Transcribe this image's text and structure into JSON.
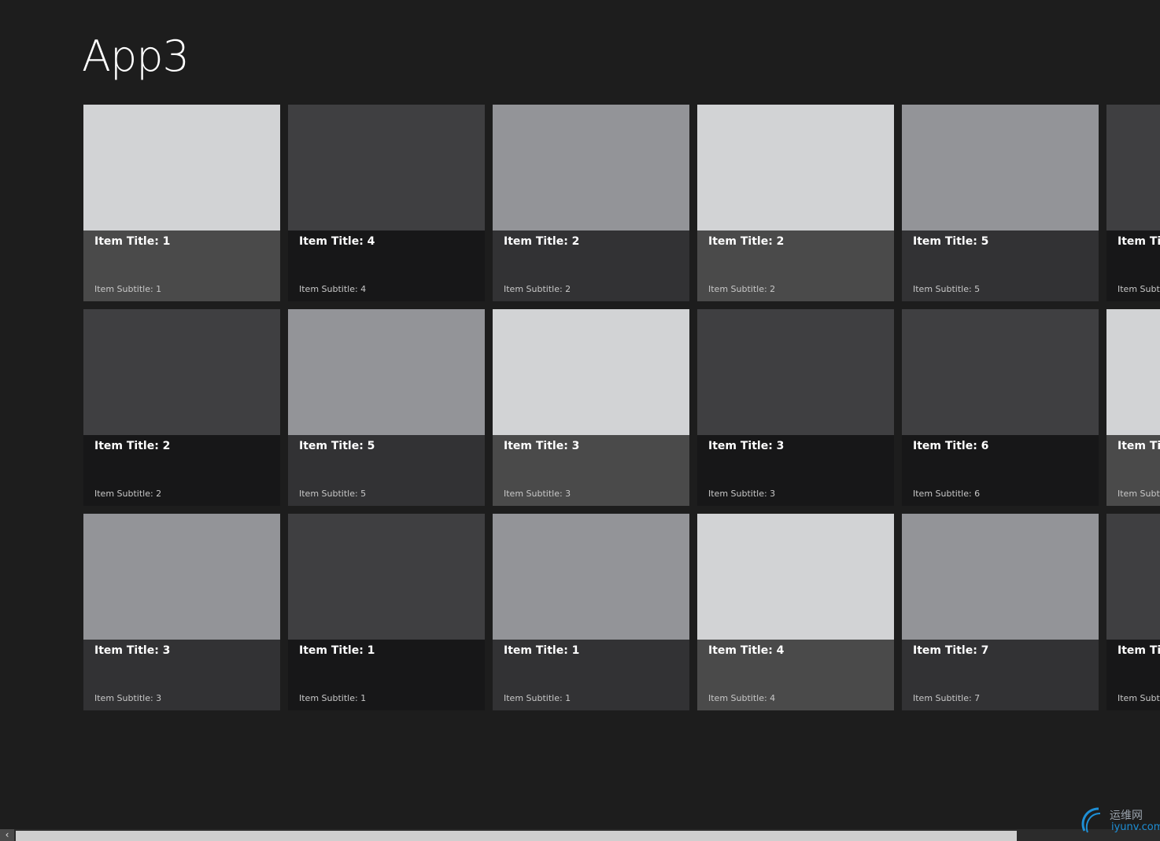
{
  "app": {
    "title": "App3"
  },
  "colors": {
    "background": "#1d1d1d",
    "image_light": "#d2d3d5",
    "image_mid": "#939498",
    "image_dark": "#3f3f41",
    "info_charcoal": "#4a4a4a",
    "info_darkgray": "#323234",
    "info_black": "#171718"
  },
  "grid": {
    "items": [
      {
        "title": "Item Title: 1",
        "subtitle": "Item Subtitle: 1",
        "image": "image_light",
        "info": "info_charcoal"
      },
      {
        "title": "Item Title: 2",
        "subtitle": "Item Subtitle: 2",
        "image": "image_dark",
        "info": "info_black"
      },
      {
        "title": "Item Title: 3",
        "subtitle": "Item Subtitle: 3",
        "image": "image_mid",
        "info": "info_darkgray"
      },
      {
        "title": "Item Title: 4",
        "subtitle": "Item Subtitle: 4",
        "image": "image_dark",
        "info": "info_black"
      },
      {
        "title": "Item Title: 5",
        "subtitle": "Item Subtitle: 5",
        "image": "image_mid",
        "info": "info_darkgray"
      },
      {
        "title": "Item Title: 1",
        "subtitle": "Item Subtitle: 1",
        "image": "image_dark",
        "info": "info_black"
      },
      {
        "title": "Item Title: 2",
        "subtitle": "Item Subtitle: 2",
        "image": "image_mid",
        "info": "info_darkgray"
      },
      {
        "title": "Item Title: 3",
        "subtitle": "Item Subtitle: 3",
        "image": "image_light",
        "info": "info_charcoal"
      },
      {
        "title": "Item Title: 1",
        "subtitle": "Item Subtitle: 1",
        "image": "image_mid",
        "info": "info_darkgray"
      },
      {
        "title": "Item Title: 2",
        "subtitle": "Item Subtitle: 2",
        "image": "image_light",
        "info": "info_charcoal"
      },
      {
        "title": "Item Title: 3",
        "subtitle": "Item Subtitle: 3",
        "image": "image_dark",
        "info": "info_black"
      },
      {
        "title": "Item Title: 4",
        "subtitle": "Item Subtitle: 4",
        "image": "image_light",
        "info": "info_charcoal"
      },
      {
        "title": "Item Title: 5",
        "subtitle": "Item Subtitle: 5",
        "image": "image_mid",
        "info": "info_darkgray"
      },
      {
        "title": "Item Title: 6",
        "subtitle": "Item Subtitle: 6",
        "image": "image_dark",
        "info": "info_black"
      },
      {
        "title": "Item Title: 7",
        "subtitle": "Item Subtitle: 7",
        "image": "image_mid",
        "info": "info_darkgray"
      },
      {
        "title": "Item Title",
        "subtitle": "Item Subtitle",
        "image": "image_dark",
        "info": "info_black"
      },
      {
        "title": "Item Title",
        "subtitle": "Item Subtitle",
        "image": "image_light",
        "info": "info_charcoal"
      },
      {
        "title": "Item Title",
        "subtitle": "Item Subtitle",
        "image": "image_dark",
        "info": "info_black"
      }
    ]
  },
  "scrollbar": {
    "left_arrow_icon": "chevron-left-icon",
    "thumb_position_fraction": 0.0,
    "visible_fraction": 0.87
  },
  "watermark": {
    "text_cn": "运维网",
    "text_en": "iyunv.com"
  }
}
